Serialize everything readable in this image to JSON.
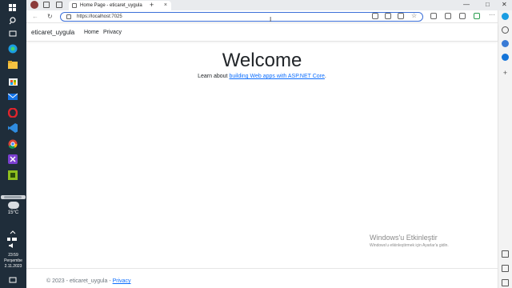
{
  "browser": {
    "tab_title": "Home Page - eticaret_uygula",
    "tab_close": "×",
    "new_tab": "+",
    "url": "https://localhost:7025",
    "window_controls": [
      "—",
      "□",
      "✕"
    ]
  },
  "site": {
    "brand": "eticaret_uygula",
    "nav": [
      "Home",
      "Privacy"
    ],
    "heading": "Welcome",
    "learn_prefix": "Learn about ",
    "learn_link": "building Web apps with ASP.NET Core",
    "learn_suffix": ".",
    "footer_prefix": "© 2023 - eticaret_uygula - ",
    "footer_link": "Privacy"
  },
  "taskbar": {
    "temperature": "15°C",
    "time": "23:59",
    "day": "Perşembe",
    "date": "2.11.2023",
    "icons": [
      "windows-start-icon",
      "search-icon",
      "task-view-icon",
      "widgets-icon",
      "edge-icon",
      "file-explorer-icon",
      "store-icon",
      "mail-icon",
      "opera-icon",
      "vscode-icon",
      "chrome-icon",
      "visual-studio-icon",
      "notepad-plus-icon"
    ]
  },
  "watermark": {
    "line1": "Windows'u Etkinleştir",
    "line2": "Windows'u etkinleştirmek için Ayarlar'a gidin."
  },
  "colors": {
    "taskbar": "#1f2d3a",
    "link": "#0d6efd",
    "address_border": "#3b6fd8"
  }
}
